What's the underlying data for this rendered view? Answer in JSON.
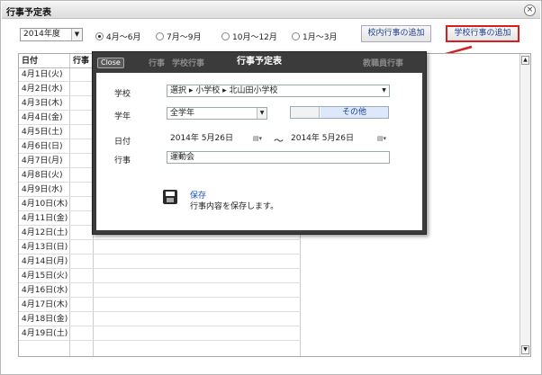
{
  "window": {
    "title": "行事予定表",
    "close_glyph": "×"
  },
  "filter": {
    "year": "2014年度",
    "terms": [
      {
        "label": "4月〜6月",
        "selected": true
      },
      {
        "label": "7月〜9月",
        "selected": false
      },
      {
        "label": "10月〜12月",
        "selected": false
      },
      {
        "label": "1月〜3月",
        "selected": false
      }
    ],
    "add_school_event": "校内行事の追加",
    "add_school_calendar_event": "学校行事の追加"
  },
  "grid": {
    "headers": {
      "date": "日付",
      "event": "行事"
    },
    "dates": [
      "4月1日(火)",
      "4月2日(水)",
      "4月3日(木)",
      "4月4日(金)",
      "4月5日(土)",
      "4月6日(日)",
      "4月7日(月)",
      "4月8日(火)",
      "4月9日(水)",
      "4月10日(木)",
      "4月11日(金)",
      "4月12日(土)",
      "4月13日(日)",
      "4月14日(月)",
      "4月15日(火)",
      "4月16日(水)",
      "4月17日(木)",
      "4月18日(金)",
      "4月19日(土)"
    ]
  },
  "modal": {
    "title": "行事予定表",
    "close": "Close",
    "ghost_headers": [
      "行事",
      "学校行事",
      "教職員行事"
    ],
    "labels": {
      "school": "学校",
      "grade": "学年",
      "date": "日付",
      "event": "行事"
    },
    "school_value": "選択 ▸ 小学校 ▸ 北山田小学校",
    "grade_value": "全学年",
    "grade_other": "その他",
    "date_from": "2014年 5月26日",
    "date_to": "2014年 5月26日",
    "date_sep": "〜",
    "event_value": "運動会",
    "save_label": "保存",
    "save_desc": "行事内容を保存します。"
  },
  "colors": {
    "highlight": "#d42020",
    "link": "#1b55c2",
    "modal_bg": "#3b3b3b"
  }
}
